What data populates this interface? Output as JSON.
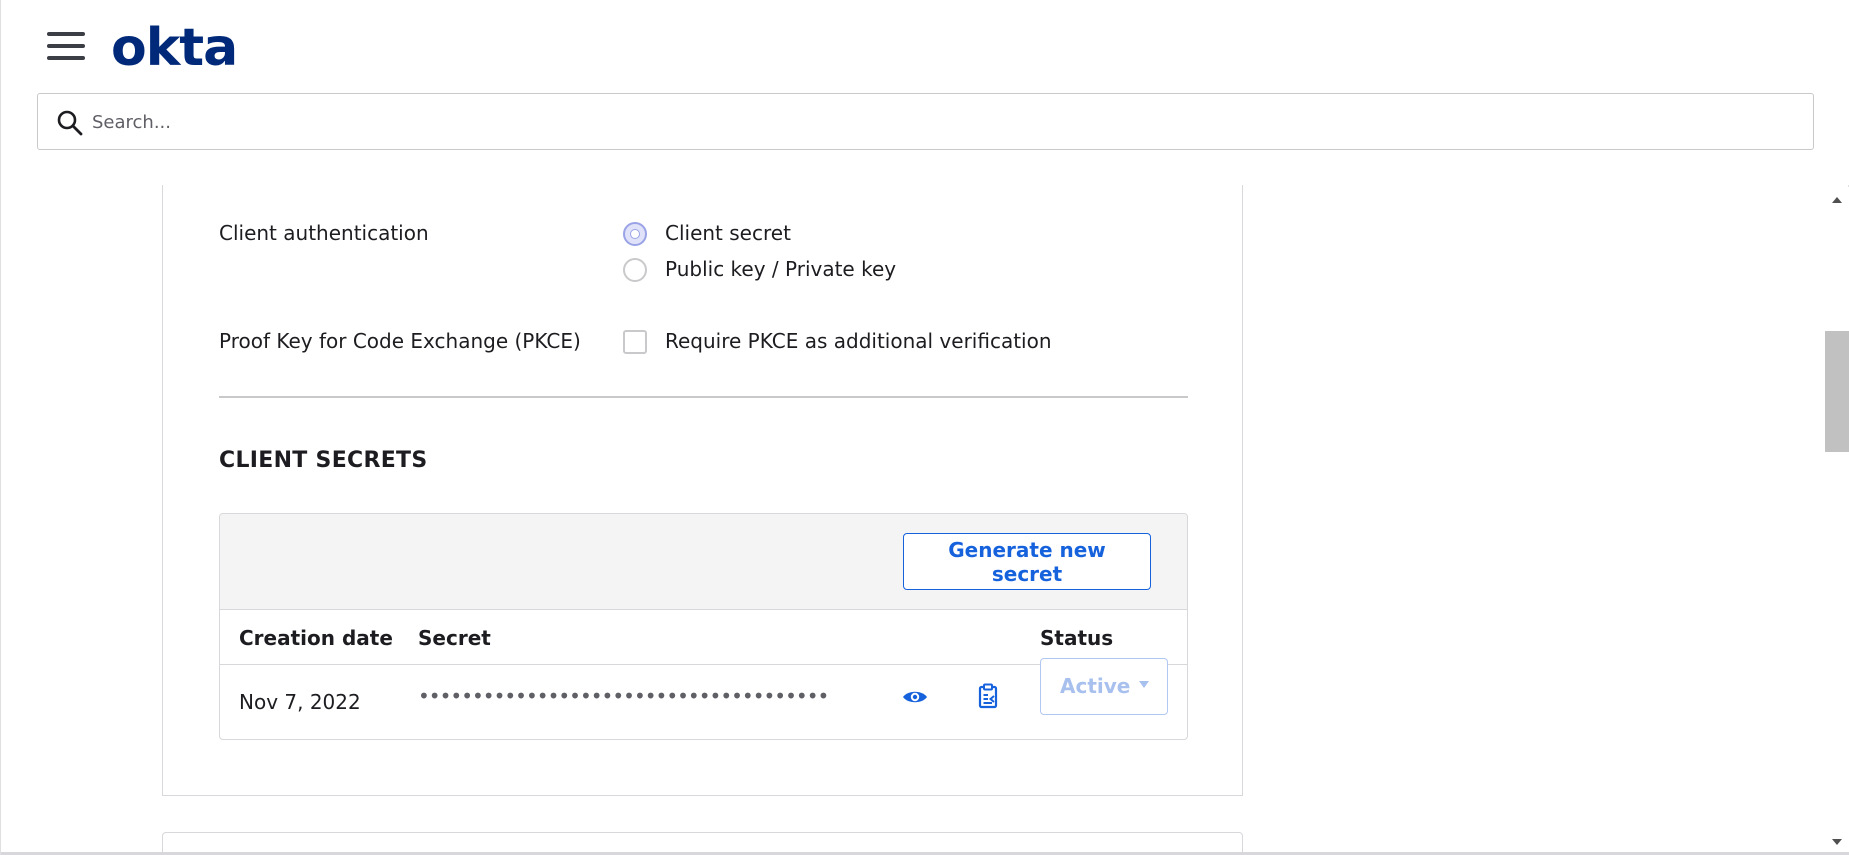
{
  "header": {
    "logo_text": "okta",
    "search": {
      "placeholder": "Search...",
      "value": ""
    }
  },
  "settings": {
    "client_authentication": {
      "label": "Client authentication",
      "options": [
        {
          "label": "Client secret",
          "selected": true
        },
        {
          "label": "Public key / Private key",
          "selected": false
        }
      ]
    },
    "pkce": {
      "label": "Proof Key for Code Exchange (PKCE)",
      "checkbox_label": "Require PKCE as additional verification",
      "checked": false
    }
  },
  "client_secrets": {
    "title": "CLIENT SECRETS",
    "generate_button": "Generate new secret",
    "columns": [
      "Creation date",
      "Secret",
      "Status"
    ],
    "rows": [
      {
        "creation_date": "Nov 7, 2022",
        "secret_masked": "••••••••••••••••••••••••••••••••••••••••",
        "status": "Active"
      }
    ]
  },
  "colors": {
    "brand": "#00297a",
    "primary_blue": "#1662dd",
    "toolbar_bg": "#f4f4f4"
  },
  "icons": {
    "menu": "hamburger-menu-icon",
    "search": "search-icon",
    "reveal": "eye-icon",
    "copy": "clipboard-icon",
    "dropdown": "chevron-down-icon"
  }
}
